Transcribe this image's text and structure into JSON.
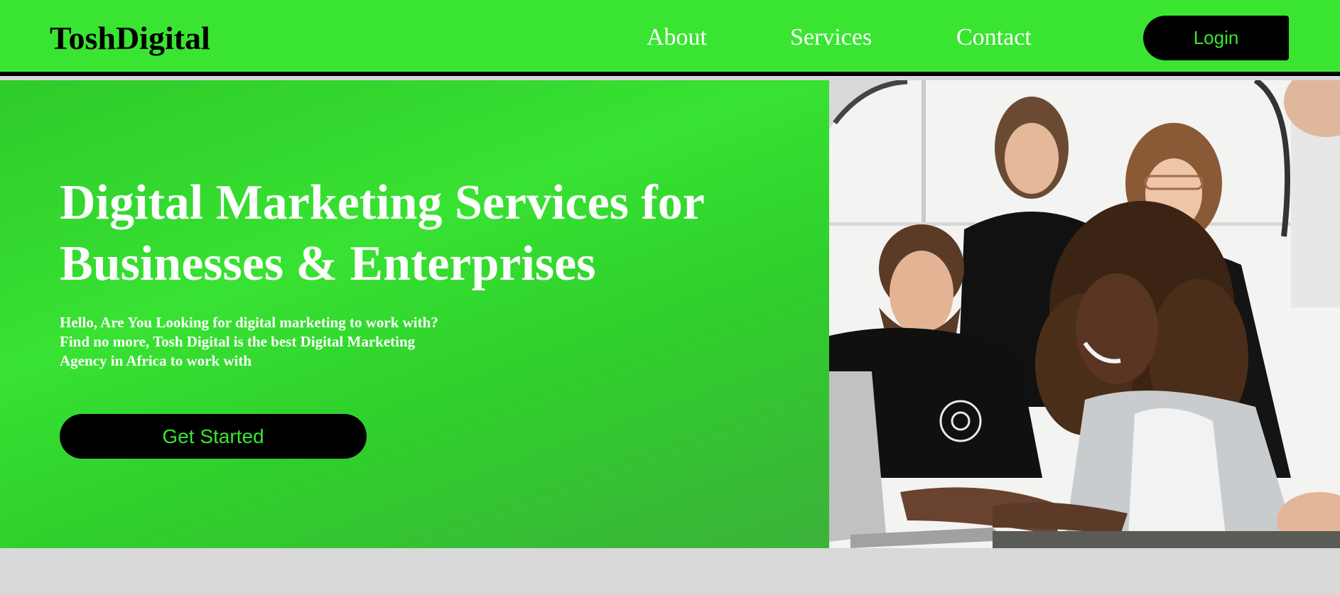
{
  "header": {
    "logo": "ToshDigital",
    "nav": {
      "about": "About",
      "services": "Services",
      "contact": "Contact"
    },
    "login_label": "Login"
  },
  "hero": {
    "title_line1": "Digital Marketing Services for",
    "title_line2": "Businesses & Enterprises",
    "description_line1": "Hello, Are You Looking for digital marketing to work with?",
    "description_line2": "Find no more, Tosh Digital is the best Digital Marketing",
    "description_line3": "Agency in Africa to work with",
    "cta_label": "Get Started"
  },
  "colors": {
    "brand_green": "#3ae532",
    "button_black": "#000000",
    "footer_gray": "#d9d9d9"
  },
  "image": {
    "subject": "team-working-at-laptop-photo"
  }
}
